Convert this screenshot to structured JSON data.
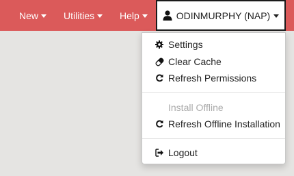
{
  "navbar": {
    "color": "#db5a5a",
    "items": [
      {
        "label": "New"
      },
      {
        "label": "Utilities"
      },
      {
        "label": "Help"
      }
    ],
    "user_menu": {
      "label": "ODINMURPHY (NAP)",
      "icon": "user-icon"
    }
  },
  "dropdown": {
    "items": [
      {
        "label": "Settings",
        "icon": "gear-icon",
        "enabled": true
      },
      {
        "label": "Clear Cache",
        "icon": "eraser-icon",
        "enabled": true
      },
      {
        "label": "Refresh Permissions",
        "icon": "refresh-icon",
        "enabled": true
      },
      {
        "label": "Install Offline",
        "icon": "",
        "enabled": false
      },
      {
        "label": "Refresh Offline Installation",
        "icon": "refresh-icon",
        "enabled": true
      },
      {
        "label": "Logout",
        "icon": "logout-icon",
        "enabled": true
      }
    ]
  }
}
